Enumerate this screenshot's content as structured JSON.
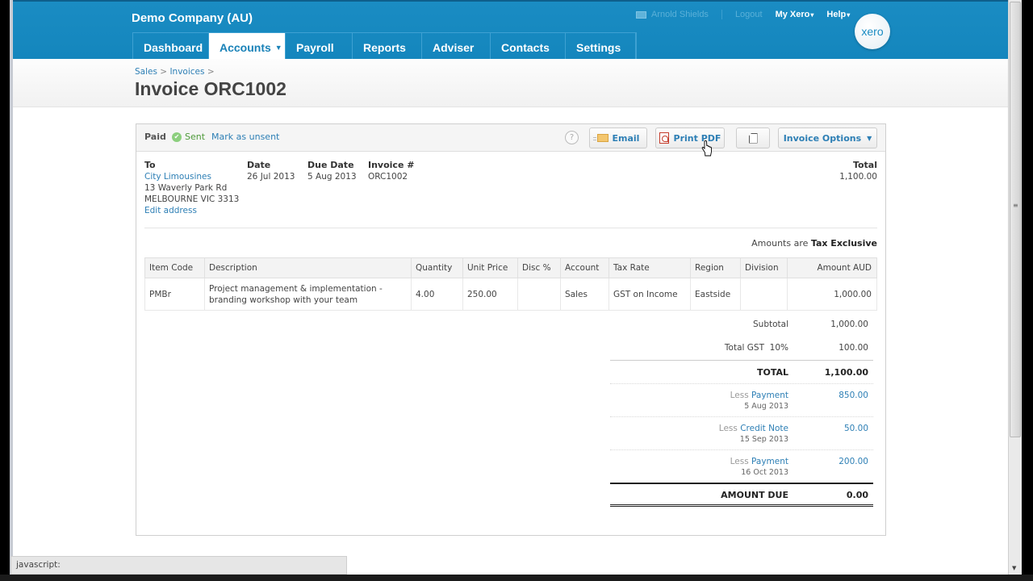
{
  "header": {
    "org_name": "Demo Company (AU)",
    "user_name": "Arnold Shields",
    "logout": "Logout",
    "my_xero": "My Xero",
    "help": "Help",
    "logo_text": "xero",
    "caret": "▾"
  },
  "nav": [
    {
      "label": "Dashboard",
      "active": false
    },
    {
      "label": "Accounts",
      "active": true,
      "dropdown": "▼"
    },
    {
      "label": "Payroll",
      "active": false
    },
    {
      "label": "Reports",
      "active": false
    },
    {
      "label": "Adviser",
      "active": false
    },
    {
      "label": "Contacts",
      "active": false
    },
    {
      "label": "Settings",
      "active": false
    }
  ],
  "breadcrumb": {
    "items": [
      "Sales",
      "Invoices"
    ],
    "separator": ">"
  },
  "page_title": "Invoice ORC1002",
  "toolbar": {
    "status": "Paid",
    "sent": "Sent",
    "mark_unsent": "Mark as unsent",
    "help_glyph": "?",
    "email": "Email",
    "print_pdf": "Print PDF",
    "invoice_options": "Invoice Options",
    "dropdown": "▼"
  },
  "invoice": {
    "to_label": "To",
    "contact": "City Limousines",
    "address_line1": "13 Waverly Park Rd",
    "address_line2": "MELBOURNE VIC 3313",
    "edit_address": "Edit address",
    "date_label": "Date",
    "date": "26 Jul 2013",
    "due_label": "Due Date",
    "due_date": "5 Aug 2013",
    "number_label": "Invoice #",
    "number": "ORC1002",
    "total_label": "Total",
    "total": "1,100.00",
    "amounts_are": "Amounts are",
    "tax_mode": "Tax Exclusive"
  },
  "table": {
    "columns": [
      "Item Code",
      "Description",
      "Quantity",
      "Unit Price",
      "Disc %",
      "Account",
      "Tax Rate",
      "Region",
      "Division",
      "Amount AUD"
    ],
    "rows": [
      {
        "item_code": "PMBr",
        "description": "Project management & implementation - branding workshop with your team",
        "quantity": "4.00",
        "unit_price": "250.00",
        "disc": "",
        "account": "Sales",
        "tax_rate": "GST on Income",
        "region": "Eastside",
        "division": "",
        "amount": "1,000.00"
      }
    ]
  },
  "totals": {
    "subtotal_label": "Subtotal",
    "subtotal": "1,000.00",
    "gst_label": "Total GST  10%",
    "gst": "100.00",
    "total_label": "TOTAL",
    "total": "1,100.00",
    "less": "Less",
    "payments": [
      {
        "type": "Payment",
        "date": "5 Aug 2013",
        "amount": "850.00"
      },
      {
        "type": "Credit Note",
        "date": "15 Sep 2013",
        "amount": "50.00"
      },
      {
        "type": "Payment",
        "date": "16 Oct 2013",
        "amount": "200.00"
      }
    ],
    "amount_due_label": "AMOUNT DUE",
    "amount_due": "0.00"
  },
  "status_bar": {
    "text": "javascript:"
  },
  "colors": {
    "brand_blue": "#1a8cc3",
    "link_blue": "#2d7fb5",
    "sent_green": "#4e9a3a"
  }
}
